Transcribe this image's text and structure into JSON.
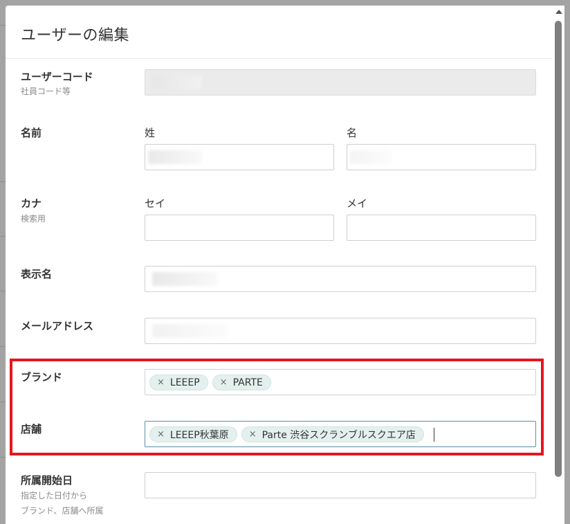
{
  "modal": {
    "title": "ユーザーの編集"
  },
  "user_code": {
    "label": "ユーザーコード",
    "sublabel": "社員コード等",
    "value": ""
  },
  "name": {
    "label": "名前",
    "last_label": "姓",
    "first_label": "名",
    "last_value": "",
    "first_value": ""
  },
  "kana": {
    "label": "カナ",
    "sublabel": "検索用",
    "last_label": "セイ",
    "first_label": "メイ",
    "last_value": "",
    "first_value": ""
  },
  "display_name": {
    "label": "表示名",
    "value": ""
  },
  "email": {
    "label": "メールアドレス",
    "value": ""
  },
  "brand": {
    "label": "ブランド",
    "tags": [
      "LEEEP",
      "PARTE"
    ]
  },
  "store": {
    "label": "店舗",
    "tags": [
      "LEEEP秋葉原",
      "Parte 渋谷スクランブルスクエア店"
    ]
  },
  "affiliation_start": {
    "label": "所属開始日",
    "sublabel_1": "指定した日付から",
    "sublabel_2": "ブランド、店舗へ所属",
    "value": ""
  },
  "icons": {
    "tag_remove": "×"
  },
  "colors": {
    "highlight": "#e3161f",
    "tag_bg": "#e3f0ee",
    "focus_border": "#5a8fa8"
  }
}
